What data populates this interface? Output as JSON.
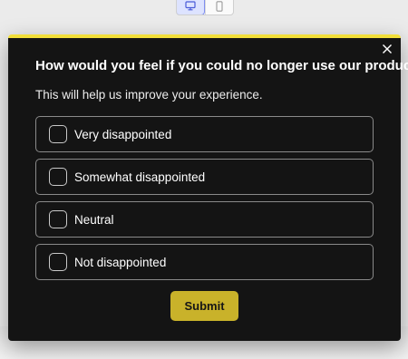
{
  "toolbar": {
    "desktop_icon": "monitor-icon",
    "mobile_icon": "phone-icon",
    "active_view": "desktop"
  },
  "survey": {
    "question": "How would you feel if you could no longer use our product?",
    "subtitle": "This will help us improve your experience.",
    "options": [
      {
        "label": "Very disappointed",
        "checked": false
      },
      {
        "label": "Somewhat disappointed",
        "checked": false
      },
      {
        "label": "Neutral",
        "checked": false
      },
      {
        "label": "Not disappointed",
        "checked": false
      }
    ],
    "submit_label": "Submit",
    "close_icon": "close-icon"
  },
  "colors": {
    "accent_bar": "#f2df3a",
    "submit_bg": "#c9b22a",
    "modal_bg": "#141414",
    "option_border": "#8a8a8a"
  }
}
